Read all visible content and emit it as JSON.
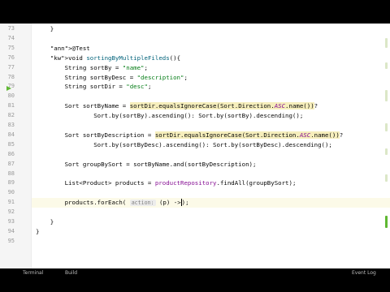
{
  "editor": {
    "lines": [
      {
        "number": "73",
        "code": "    }"
      },
      {
        "number": "74",
        "code": ""
      },
      {
        "number": "75",
        "code": "    @Test"
      },
      {
        "number": "76",
        "code": "    void sortingByMultipleFileds(){"
      },
      {
        "number": "77",
        "code": "        String sortBy = \"name\";"
      },
      {
        "number": "78",
        "code": "        String sortByDesc = \"description\";"
      },
      {
        "number": "79",
        "code": "        String sortDir = \"desc\";"
      },
      {
        "number": "80",
        "code": ""
      },
      {
        "number": "81",
        "code": "        Sort sortByName = sortDir.equalsIgnoreCase(Sort.Direction.ASC.name())?"
      },
      {
        "number": "82",
        "code": "                Sort.by(sortBy).ascending(): Sort.by(sortBy).descending();"
      },
      {
        "number": "83",
        "code": ""
      },
      {
        "number": "84",
        "code": "        Sort sortByDescription = sortDir.equalsIgnoreCase(Sort.Direction.ASC.name())?"
      },
      {
        "number": "85",
        "code": "                Sort.by(sortByDesc).ascending(): Sort.by(sortByDesc).descending();"
      },
      {
        "number": "86",
        "code": ""
      },
      {
        "number": "87",
        "code": "        Sort groupBySort = sortByName.and(sortByDescription);"
      },
      {
        "number": "88",
        "code": ""
      },
      {
        "number": "89",
        "code": "        List<Product> products = productRepository.findAll(groupBySort);"
      },
      {
        "number": "90",
        "code": ""
      },
      {
        "number": "91",
        "code": "        products.forEach( action: (p) ->);"
      },
      {
        "number": "92",
        "code": ""
      },
      {
        "number": "93",
        "code": "    }"
      },
      {
        "number": "94",
        "code": "}"
      },
      {
        "number": "95",
        "code": ""
      }
    ],
    "parameter_hint": "action:",
    "current_line": "91"
  },
  "bottom_bar": {
    "left_1": "Terminal",
    "left_2": "Build",
    "right": "Event Log"
  },
  "colors": {
    "keyword": "#0033b3",
    "string": "#067d17",
    "annotation": "#9e880d",
    "method": "#00627a",
    "field": "#871094"
  }
}
